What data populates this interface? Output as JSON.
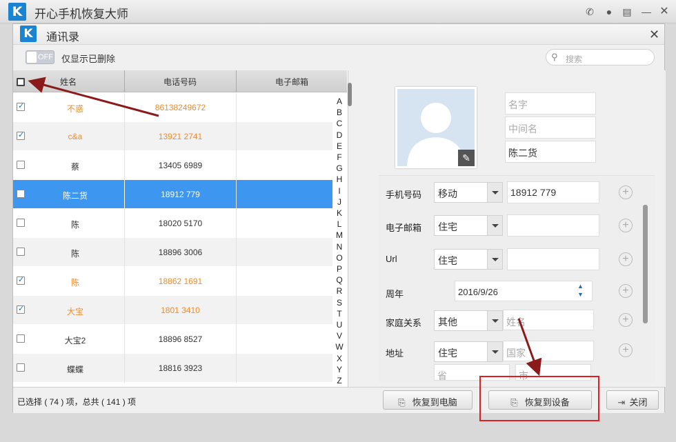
{
  "app": {
    "title": "开心手机恢复大师",
    "logo": "K"
  },
  "dialog": {
    "title": "通讯录",
    "logo": "K"
  },
  "toolbar": {
    "toggle_state": "OFF",
    "filter_label": "仅显示已删除",
    "search_placeholder": "搜索"
  },
  "table": {
    "headers": [
      "姓名",
      "电话号码",
      "电子邮箱"
    ],
    "rows": [
      {
        "checked": true,
        "name": "不惑",
        "phone": "86138249672",
        "color": "orange",
        "selected": false
      },
      {
        "checked": true,
        "name": "c&a",
        "phone": "13921 2741",
        "color": "orange",
        "selected": false
      },
      {
        "checked": false,
        "name": "蔡",
        "phone": "13405 6989",
        "color": "normal",
        "selected": false
      },
      {
        "checked": false,
        "name": "陈二货",
        "phone": "18912 779",
        "color": "normal",
        "selected": true
      },
      {
        "checked": false,
        "name": "陈",
        "phone": "18020 5170",
        "color": "normal",
        "selected": false
      },
      {
        "checked": false,
        "name": "陈",
        "phone": "18896 3006",
        "color": "normal",
        "selected": false
      },
      {
        "checked": true,
        "name": "陈",
        "phone": "18862 1691",
        "color": "orange",
        "selected": false
      },
      {
        "checked": true,
        "name": "大宝",
        "phone": "1801 3410",
        "color": "orange",
        "selected": false
      },
      {
        "checked": false,
        "name": "大宝2",
        "phone": "18896 8527",
        "color": "normal",
        "selected": false
      },
      {
        "checked": false,
        "name": "蝶蝶",
        "phone": "18816 3923",
        "color": "normal",
        "selected": false
      }
    ],
    "alphabet": [
      "A",
      "B",
      "C",
      "D",
      "E",
      "F",
      "G",
      "H",
      "I",
      "J",
      "K",
      "L",
      "M",
      "N",
      "O",
      "P",
      "Q",
      "R",
      "S",
      "T",
      "U",
      "V",
      "W",
      "X",
      "Y",
      "Z"
    ]
  },
  "detail": {
    "name_placeholder": "名字",
    "middle_placeholder": "中间名",
    "last_name": "陈二货",
    "phone_label": "手机号码",
    "phone_type": "移动",
    "phone_value": "18912 779",
    "email_label": "电子邮箱",
    "email_type": "住宅",
    "url_label": "Url",
    "url_type": "住宅",
    "anniv_label": "周年",
    "anniv_value": "2016/9/26",
    "family_label": "家庭关系",
    "family_type": "其他",
    "family_placeholder": "姓名",
    "addr_label": "地址",
    "addr_type": "住宅",
    "country_placeholder": "国家",
    "province_placeholder": "省",
    "city_placeholder": "市"
  },
  "footer": {
    "status": "已选择 ( 74 ) 项，总共 ( 141 ) 项",
    "restore_pc": "恢复到电脑",
    "restore_device": "恢复到设备",
    "close": "关闭"
  },
  "colors": {
    "accent": "#3d96f0",
    "orange": "#f08c2a",
    "annotation": "#8b1a1a",
    "highlight": "#e02020"
  }
}
